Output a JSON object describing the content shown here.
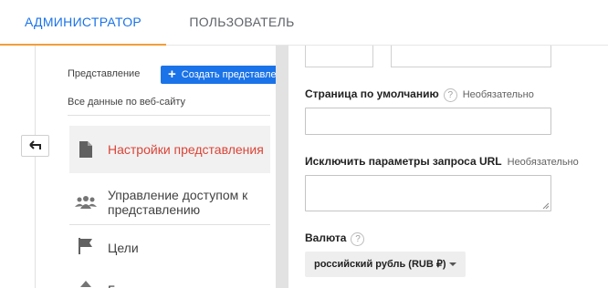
{
  "tabs": [
    {
      "label": "АДМИНИСТРАТОР",
      "active": true
    },
    {
      "label": "ПОЛЬЗОВАТЕЛЬ",
      "active": false
    }
  ],
  "colors": {
    "accent": "#1a73e8",
    "tab_underline": "#f29e3a",
    "active_item": "#db4437"
  },
  "left": {
    "view_label": "Представление",
    "create_button": "Создать представление",
    "view_name": "Все данные по веб-сайту",
    "items": [
      {
        "label": "Настройки представления",
        "icon": "document-icon",
        "active": true
      },
      {
        "label": "Управление доступом к представлению",
        "icon": "people-icon",
        "active": false
      },
      {
        "label": "Цели",
        "icon": "flag-icon",
        "active": false
      },
      {
        "label": "Г",
        "icon": "arrows-icon",
        "active": false
      }
    ]
  },
  "form": {
    "default_page": {
      "label": "Страница по умолчанию",
      "optional": "Необязательно",
      "value": ""
    },
    "exclude_params": {
      "label": "Исключить параметры запроса URL",
      "optional": "Необязательно",
      "value": ""
    },
    "currency": {
      "label": "Валюта",
      "value": "российский рубль (RUB ₽)"
    }
  },
  "help_glyph": "?"
}
